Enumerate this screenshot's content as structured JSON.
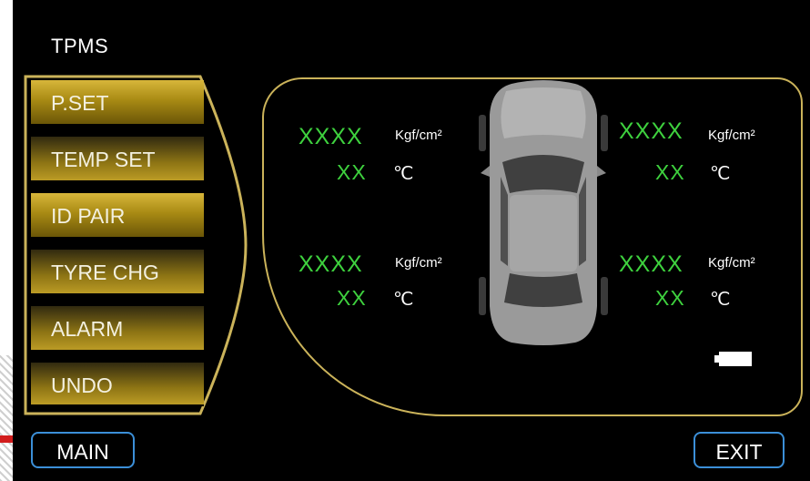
{
  "title": "TPMS",
  "menu": [
    {
      "label": "P.SET"
    },
    {
      "label": "TEMP SET"
    },
    {
      "label": "ID PAIR"
    },
    {
      "label": "TYRE CHG"
    },
    {
      "label": "ALARM"
    },
    {
      "label": "UNDO"
    }
  ],
  "tyres": {
    "front_left": {
      "pressure": "XXXX",
      "pressure_unit": "Kgf/cm²",
      "temp": "XX",
      "temp_unit": "℃"
    },
    "front_right": {
      "pressure": "XXXX",
      "pressure_unit": "Kgf/cm²",
      "temp": "XX",
      "temp_unit": "℃"
    },
    "rear_left": {
      "pressure": "XXXX",
      "pressure_unit": "Kgf/cm²",
      "temp": "XX",
      "temp_unit": "℃"
    },
    "rear_right": {
      "pressure": "XXXX",
      "pressure_unit": "Kgf/cm²",
      "temp": "XX",
      "temp_unit": "℃"
    }
  },
  "buttons": {
    "main": "MAIN",
    "exit": "EXIT"
  },
  "colors": {
    "value_green": "#3ed13e",
    "menu_gold": "#c9a92a",
    "button_border": "#3b8fd8"
  }
}
